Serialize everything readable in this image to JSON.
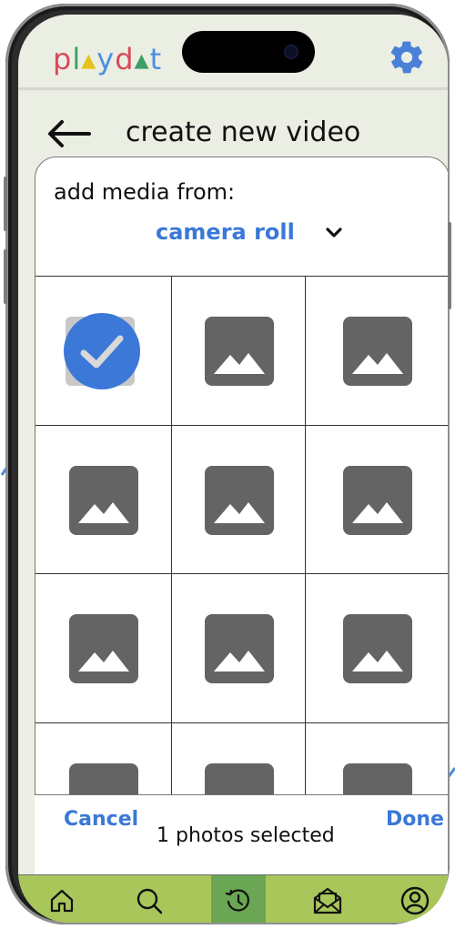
{
  "app": {
    "logo_text": "playdat"
  },
  "header": {
    "title": "create new video"
  },
  "media_picker": {
    "prompt": "add media from:",
    "source": "camera roll",
    "selected_count_text": "1 photos selected",
    "cancel_label": "Cancel",
    "done_label": "Done"
  },
  "icons": {
    "settings": "gear-icon",
    "back": "left-arrow-icon",
    "dropdown": "chevron-down-icon",
    "photo": "image-placeholder-icon",
    "selected": "checkmark-icon",
    "nav": [
      "home-icon",
      "search-icon",
      "history-icon",
      "mail-icon",
      "profile-icon"
    ]
  },
  "colors": {
    "accent_blue": "#3b78d8",
    "nav_green": "#a9c65b",
    "nav_active": "#6aa653",
    "header_bg": "#ebeee3",
    "logo_colors": [
      "#d84a5a",
      "#e8c21c",
      "#4a90e2",
      "#3f9f63"
    ]
  }
}
